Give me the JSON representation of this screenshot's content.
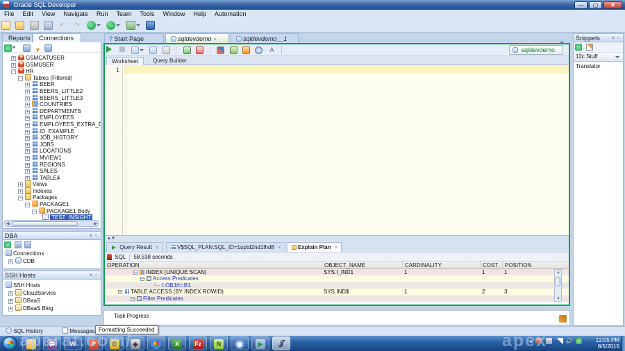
{
  "window": {
    "title": "Oracle SQL Developer",
    "clock_time": "12:05 PM",
    "clock_date": "8/5/2015"
  },
  "menu": {
    "items": [
      "File",
      "Edit",
      "View",
      "Navigate",
      "Run",
      "Team",
      "Tools",
      "Window",
      "Help",
      "Automation"
    ]
  },
  "left": {
    "tabs": {
      "reports": "Reports",
      "connections": "Connections"
    },
    "tree": [
      {
        "label": "GSMCATUSER"
      },
      {
        "label": "GSMUSER"
      },
      {
        "label": "HR"
      },
      {
        "label": "Tables (Filtered)"
      },
      {
        "label": "BEER"
      },
      {
        "label": "BEERS_LITTLE2"
      },
      {
        "label": "BEERS_LITTLE3"
      },
      {
        "label": "COUNTRIES"
      },
      {
        "label": "DEPARTMENTS"
      },
      {
        "label": "EMPLOYEES"
      },
      {
        "label": "EMPLOYEES_EXTRA_DA"
      },
      {
        "label": "ID_EXAMPLE"
      },
      {
        "label": "JOB_HISTORY"
      },
      {
        "label": "JOBS"
      },
      {
        "label": "LOCATIONS"
      },
      {
        "label": "MVIEW1"
      },
      {
        "label": "REGIONS"
      },
      {
        "label": "SALES"
      },
      {
        "label": "TABLE4"
      },
      {
        "label": "Views"
      },
      {
        "label": "Indexes"
      },
      {
        "label": "Packages"
      },
      {
        "label": "PACKAGE1"
      },
      {
        "label": "PACKAGE1 Body"
      },
      {
        "label": "TEST_INSIGHT"
      },
      {
        "label": "test_insight"
      }
    ],
    "dba": {
      "title": "DBA",
      "connections_label": "Connections",
      "cdb_label": "CDB"
    },
    "ssh": {
      "title": "SSH Hosts",
      "root_label": "SSH Hosts",
      "items": [
        {
          "label": "CloudService"
        },
        {
          "label": "DBaaS"
        },
        {
          "label": "DBaaS Blog"
        }
      ]
    }
  },
  "main": {
    "tabs": {
      "start_page": "Start Page",
      "doc1": "sqldevdemo",
      "doc2": "sqldevdemo__1"
    },
    "connection_combo": "sqldevdemo",
    "subtabs": {
      "worksheet": "Worksheet",
      "query_builder": "Query Builder"
    },
    "editor": {
      "line_number": "1"
    }
  },
  "results": {
    "tabs": {
      "query_result": "Query Result",
      "vsql_plan": "V$SQL_PLAN.SQL_ID=1uptd2nd1fhd8",
      "explain_plan": "Explain Plan"
    },
    "sql_label": "SQL",
    "elapsed": "58.538 seconds",
    "grid": {
      "columns": [
        "OPERATION",
        "OBJECT_NAME",
        "CARDINALITY",
        "COST",
        "POSITION"
      ],
      "rows": [
        {
          "operation": "INDEX (UNIQUE SCAN)",
          "object_name": "SYS.I_IND1",
          "cardinality": "1",
          "cost": "1",
          "position": "1"
        },
        {
          "operation": "Access Predicates",
          "object_name": "",
          "cardinality": "",
          "cost": "",
          "position": ""
        },
        {
          "operation": "I.OBJ#=:B1",
          "object_name": "",
          "cardinality": "",
          "cost": "",
          "position": ""
        },
        {
          "operation": "TABLE ACCESS (BY INDEX ROWID)",
          "object_name": "SYS.IND$",
          "cardinality": "1",
          "cost": "2",
          "position": "3"
        },
        {
          "operation": "Filter Predicates",
          "object_name": "",
          "cardinality": "",
          "cost": "",
          "position": ""
        }
      ]
    }
  },
  "task_progress": {
    "label": "Task Progress"
  },
  "snippets": {
    "title": "Snippets",
    "category": "12c Stuff",
    "items": [
      {
        "label": "Translator"
      }
    ]
  },
  "statusbar": {
    "sql_history": "SQL History",
    "messages_log": "Messages - Log"
  },
  "tooltip": {
    "text": "Formatting Succeeded"
  },
  "watermark": {
    "prefix": "aparat.com/",
    "suffix": "apex"
  },
  "taskbar": {
    "icon_names": [
      "windows-start",
      "file-explorer",
      "chat-app",
      "word",
      "powerpoint",
      "outlook",
      "virtualbox",
      "chrome",
      "excel",
      "filezilla",
      "notepad-editor",
      "screen-recorder",
      "sql-runner",
      "jdeveloper"
    ]
  }
}
